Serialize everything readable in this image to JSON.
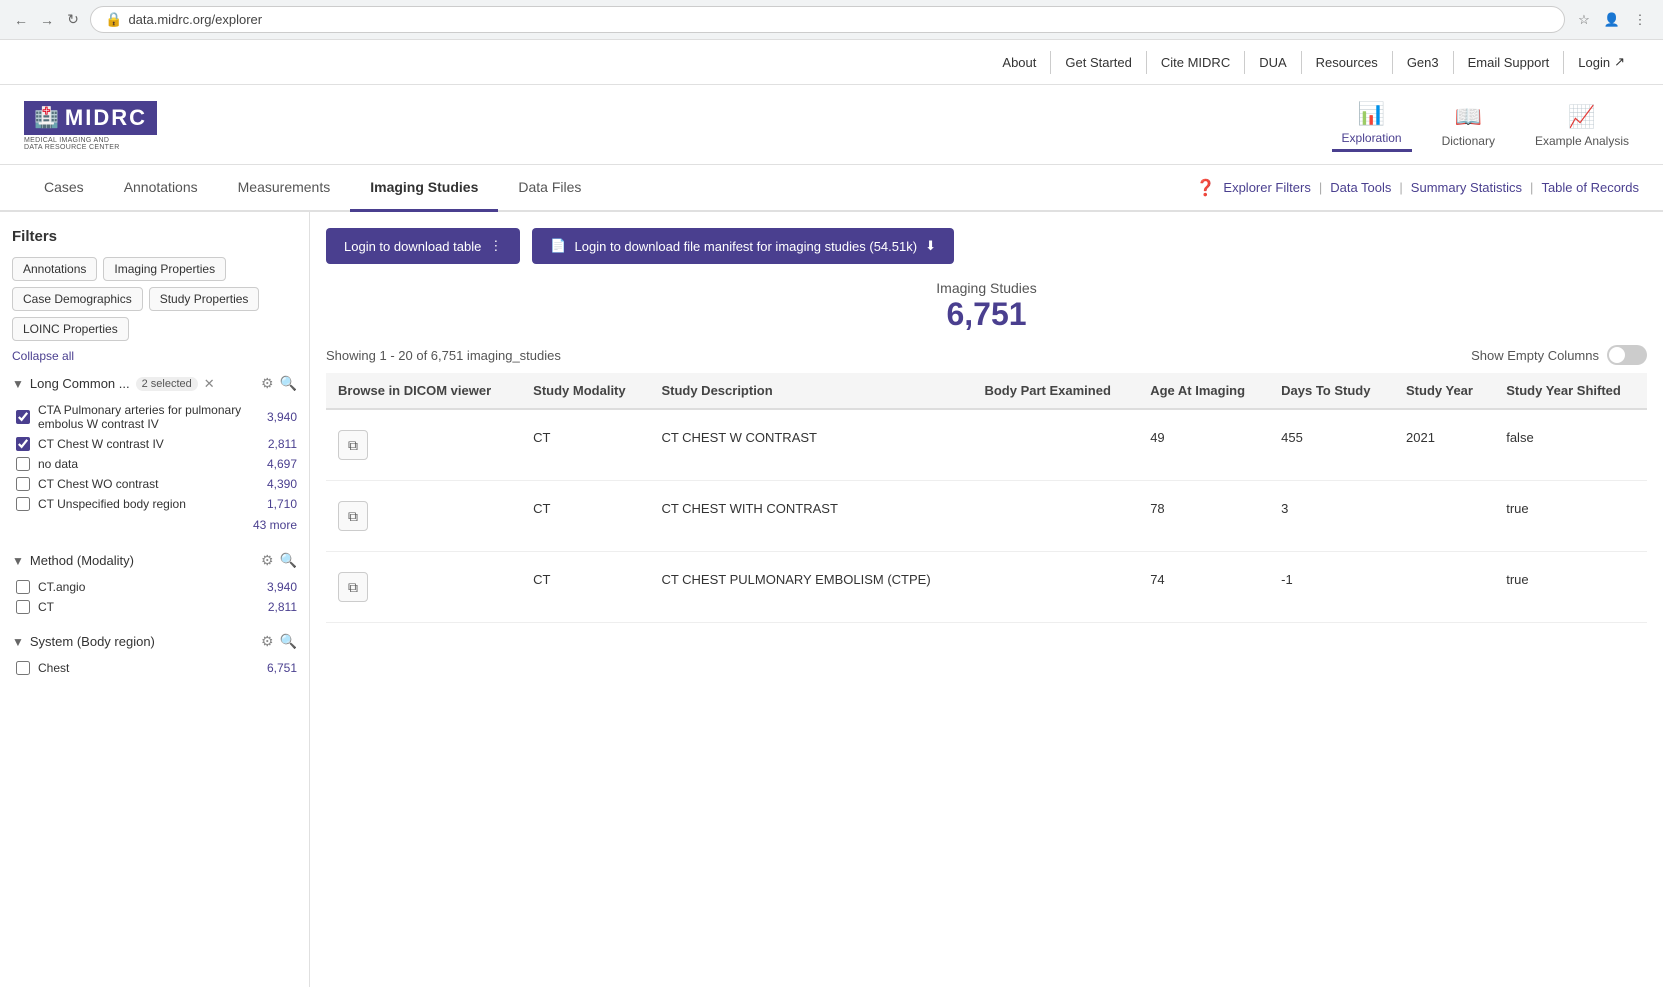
{
  "browser": {
    "url": "data.midrc.org/explorer",
    "back": "←",
    "forward": "→",
    "reload": "↻"
  },
  "top_nav": {
    "items": [
      "About",
      "Get Started",
      "Cite MIDRC",
      "DUA",
      "Resources",
      "Gen3",
      "Email Support",
      "Login"
    ]
  },
  "header": {
    "logo_text": "MIDRC",
    "logo_subtitle": "MEDICAL IMAGING AND DATA RESOURCE CENTER",
    "nav_items": [
      {
        "id": "exploration",
        "label": "Exploration",
        "active": true
      },
      {
        "id": "dictionary",
        "label": "Dictionary",
        "active": false
      },
      {
        "id": "example-analysis",
        "label": "Example Analysis",
        "active": false
      }
    ]
  },
  "tabs": {
    "items": [
      "Cases",
      "Annotations",
      "Measurements",
      "Imaging Studies",
      "Data Files"
    ],
    "active": "Imaging Studies"
  },
  "quick_links": {
    "help": "?",
    "explorer_filters": "Explorer Filters",
    "data_tools": "Data Tools",
    "summary_statistics": "Summary Statistics",
    "table_of_records": "Table of Records"
  },
  "sidebar": {
    "title": "Filters",
    "filter_tabs": [
      "Annotations",
      "Imaging Properties",
      "Case Demographics",
      "Study Properties",
      "LOINC Properties"
    ],
    "collapse_all": "Collapse all",
    "filter_groups": [
      {
        "id": "long-common",
        "name": "Long Common ...",
        "selected_count": "2 selected",
        "items": [
          {
            "label": "CTA Pulmonary arteries for pulmonary embolus W contrast IV",
            "count": "3,940",
            "checked": true
          },
          {
            "label": "CT Chest W contrast IV",
            "count": "2,811",
            "checked": true
          },
          {
            "label": "no data",
            "count": "4,697",
            "checked": false
          },
          {
            "label": "CT Chest WO contrast",
            "count": "4,390",
            "checked": false
          },
          {
            "label": "CT Unspecified body region",
            "count": "1,710",
            "checked": false
          }
        ],
        "more": "43 more"
      },
      {
        "id": "method-modality",
        "name": "Method (Modality)",
        "selected_count": null,
        "items": [
          {
            "label": "CT.angio",
            "count": "3,940",
            "checked": false
          },
          {
            "label": "CT",
            "count": "2,811",
            "checked": false
          }
        ],
        "more": null
      },
      {
        "id": "system-body-region",
        "name": "System (Body region)",
        "selected_count": null,
        "items": [
          {
            "label": "Chest",
            "count": "6,751",
            "checked": false
          }
        ],
        "more": null
      }
    ]
  },
  "content": {
    "btn_download_table": "Login to download table",
    "btn_download_manifest": "Login to download file manifest for imaging studies (54.51k)",
    "stats_label": "Imaging Studies",
    "stats_number": "6,751",
    "showing_text": "Showing 1 - 20 of 6,751 imaging_studies",
    "show_empty_label": "Show Empty Columns",
    "table": {
      "columns": [
        "Browse in DICOM viewer",
        "Study Modality",
        "Study Description",
        "Body Part Examined",
        "Age At Imaging",
        "Days To Study",
        "Study Year",
        "Study Year Shifted"
      ],
      "rows": [
        {
          "dicom": true,
          "modality": "CT",
          "description": "CT CHEST W CONTRAST",
          "body_part": "",
          "age": "49",
          "days": "455",
          "year": "2021",
          "shifted": "false"
        },
        {
          "dicom": true,
          "modality": "CT",
          "description": "CT CHEST WITH CONTRAST",
          "body_part": "",
          "age": "78",
          "days": "3",
          "year": "",
          "shifted": "true"
        },
        {
          "dicom": true,
          "modality": "CT",
          "description": "CT CHEST PULMONARY EMBOLISM (CTPE)",
          "body_part": "",
          "age": "74",
          "days": "-1",
          "year": "",
          "shifted": "true"
        }
      ]
    }
  }
}
